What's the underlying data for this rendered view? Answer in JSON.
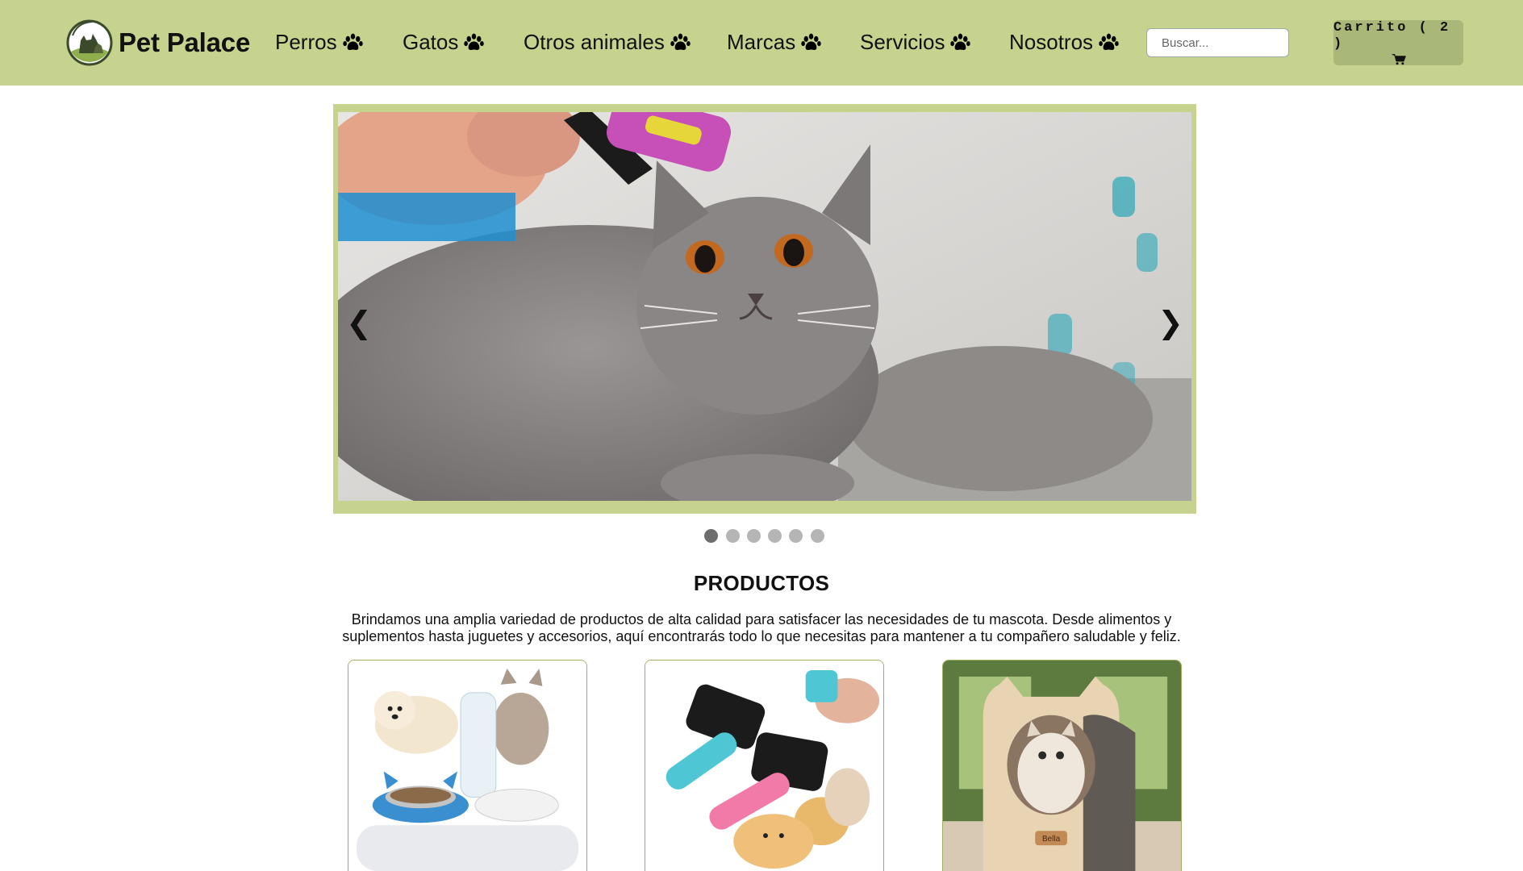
{
  "brand": {
    "name": "Pet Palace",
    "logo_icon": "pet-palace-logo-icon"
  },
  "nav": {
    "items": [
      {
        "label": "Perros",
        "icon": "paw-icon"
      },
      {
        "label": "Gatos",
        "icon": "paw-icon"
      },
      {
        "label": "Otros animales",
        "icon": "paw-icon"
      },
      {
        "label": "Marcas",
        "icon": "paw-icon"
      },
      {
        "label": "Servicios",
        "icon": "paw-icon"
      },
      {
        "label": "Nosotros",
        "icon": "paw-icon"
      }
    ]
  },
  "search": {
    "placeholder": "Buscar...",
    "value": ""
  },
  "cart": {
    "label": "Carrito ( 2 )",
    "icon": "shopping-cart-icon"
  },
  "slider": {
    "prev": "❮",
    "next": "❯",
    "slide_count": 6,
    "active_slide": 1,
    "image": "gray cat being brushed"
  },
  "products": {
    "title": "PRODUCTOS",
    "description": "Brindamos una amplia variedad de productos de alta calidad para satisfacer las necesidades de tu mascota. Desde alimentos y suplementos hasta juguetes y accesorios, aquí encontrarás todo lo que necesitas para mantener a tu compañero saludable y feliz.",
    "cards": [
      {
        "image": "pet food bowl with water dispenser, puppy and kitten"
      },
      {
        "image": "pet grooming brushes with small dog and cat"
      },
      {
        "image": "cat-shaped wooden cat house",
        "tag": "Bella"
      }
    ]
  },
  "colors": {
    "header_bg": "#c5d38f",
    "cart_bg": "#a9b879",
    "slider_frame": "#c5d38f",
    "dot_active": "#6e6e6e",
    "dot_inactive": "#b5b5b5"
  }
}
